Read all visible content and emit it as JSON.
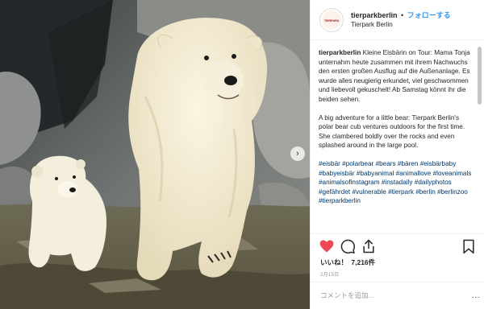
{
  "header": {
    "avatar_text": "TIERPARK",
    "username": "tierparkberlin",
    "separator": "•",
    "follow_label": "フォローする",
    "location": "Tierpark Berlin"
  },
  "caption": {
    "username": "tierparkberlin",
    "german_text": "Kleine Eisbärin on Tour: Mama Tonja unternahm heute zusammen mit ihrem Nachwuchs den ersten großen Ausflug auf die Außenanlage. Es wurde alles neugierig erkundet, viel geschwommen und liebevoll gekuschelt! Ab Samstag könnt ihr die beiden sehen.",
    "english_text": "A big adventure for a little bear: Tierpark Berlin's polar bear cub ventures outdoors for the first time. She clambered boldly over the rocks and even splashed around in the large pool.",
    "hashtags": [
      "#eisbär",
      "#polarbear",
      "#bears",
      "#bären",
      "#eisbärbaby",
      "#babyeisbär",
      "#babyanimal",
      "#animallove",
      "#loveanimals",
      "#animalsofinstagram",
      "#instadaily",
      "#dailyphotos",
      "#gefährdet",
      "#vulnerable",
      "#tierpark",
      "#berlin",
      "#berlinzoo",
      "#tierparkberlin"
    ]
  },
  "actions": {
    "like_icon": "heart-icon",
    "comment_icon": "comment-icon",
    "share_icon": "share-icon",
    "save_icon": "bookmark-icon"
  },
  "likes": {
    "label": "いいね！",
    "count": "7,216件"
  },
  "date": "2月15日",
  "comment_box": {
    "placeholder": "コメントを追加...",
    "more": "..."
  },
  "media": {
    "next_arrow": "›"
  },
  "colors": {
    "accent": "#3897f0",
    "like_red": "#ed4956",
    "hashtag": "#003569"
  }
}
